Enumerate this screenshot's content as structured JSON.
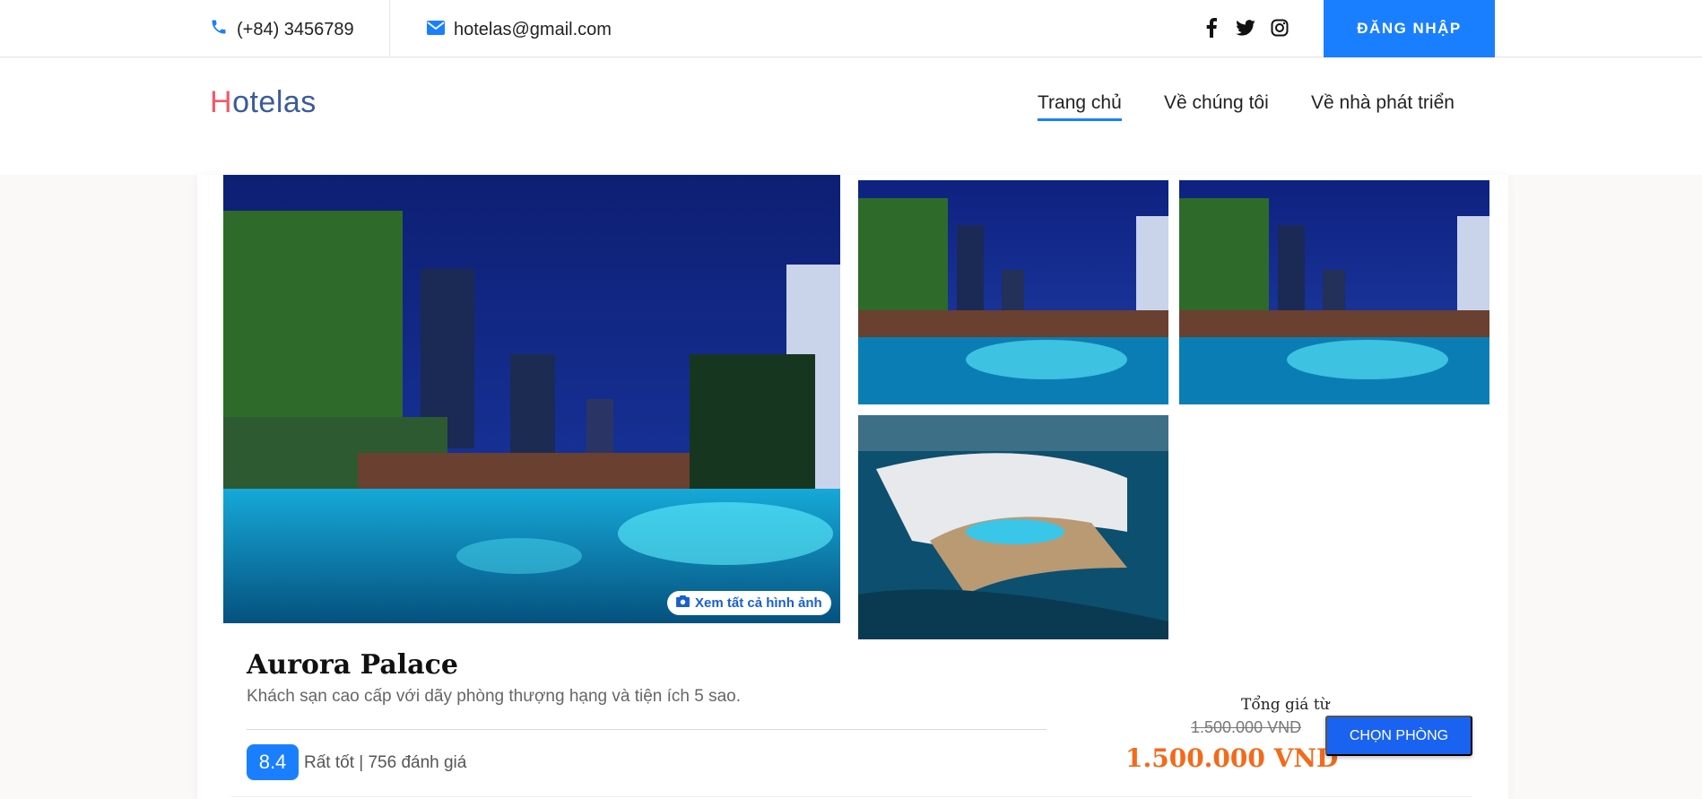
{
  "topbar": {
    "phone": "(+84) 3456789",
    "email": "hotelas@gmail.com",
    "social": [
      "facebook-icon",
      "twitter-icon",
      "instagram-icon"
    ],
    "login_label": "ĐĂNG NHẬP"
  },
  "header": {
    "logo_first": "H",
    "logo_rest": "otelas",
    "nav": [
      "Trang chủ",
      "Về chúng tôi",
      "Về nhà phát triển"
    ],
    "active_nav": "Trang chủ"
  },
  "gallery": {
    "view_all_label": "Xem tất cả hình ảnh"
  },
  "hotel": {
    "name": "Aurora Palace",
    "description": "Khách sạn cao cấp với dãy phòng thượng hạng và tiện ích 5 sao.",
    "score": "8.4",
    "rating_text": "Rất tốt | 756 đánh giá"
  },
  "pricing": {
    "from_label": "Tổng giá từ",
    "old_price": "1.500.000 VND",
    "new_price": "1.500.000 VND",
    "choose_label": "CHỌN PHÒNG"
  },
  "colors": {
    "accent": "#1a7fff",
    "price": "#f26a1b",
    "logo_h": "#ef5a6a",
    "logo_text": "#3b5b9c"
  }
}
